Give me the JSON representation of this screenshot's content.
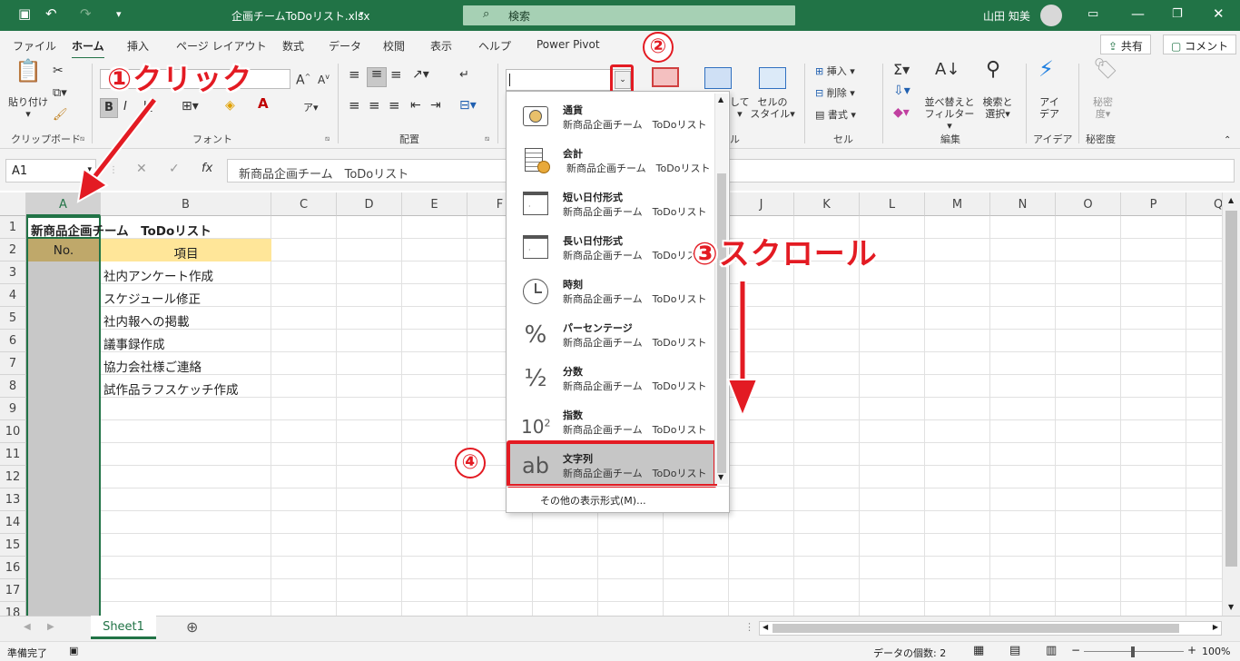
{
  "title": {
    "filename": "企画チームToDoリスト.xlsx",
    "search_placeholder": "検索",
    "user_name": "山田 知美"
  },
  "menu": {
    "tabs": [
      "ファイル",
      "ホーム",
      "挿入",
      "ページ レイアウト",
      "数式",
      "データ",
      "校閲",
      "表示",
      "ヘルプ",
      "Power Pivot"
    ],
    "active": "ホーム",
    "share": "共有",
    "comment": "コメント"
  },
  "ribbon": {
    "paste": "貼り付け",
    "clipboard": "クリップボード",
    "font": "フォント",
    "alignment": "配置",
    "cells": "セル",
    "editing": "編集",
    "ideas": "アイデア",
    "sensitivity": "秘密度",
    "insert": "挿入",
    "delete": "削除",
    "format": "書式",
    "sort_filter_1": "並べ替えと",
    "sort_filter_2": "フィルター",
    "find_select_1": "検索と",
    "find_select_2": "選択",
    "ideas_btn_1": "アイ",
    "ideas_btn_2": "デア",
    "sens_btn_1": "秘密",
    "sens_btn_2": "度",
    "cell_style_1": "セルの",
    "cell_style_2": "スタイル",
    "table_partial": "して",
    "font_bold": "B",
    "font_italic": "I",
    "font_underline": "U",
    "group_cells_partial": "ル"
  },
  "formula_bar": {
    "name_box": "A1",
    "formula": "新商品企画チーム　ToDoリスト"
  },
  "columns": [
    "A",
    "B",
    "C",
    "D",
    "E",
    "F",
    "",
    "",
    "",
    "J",
    "K",
    "L",
    "M",
    "N",
    "O",
    "P",
    "Q"
  ],
  "rows": [
    "1",
    "2",
    "3",
    "4",
    "5",
    "6",
    "7",
    "8",
    "9",
    "10",
    "11",
    "12",
    "13",
    "14",
    "15",
    "16",
    "17",
    "18"
  ],
  "cells": {
    "a1": "新商品企画チーム　ToDoリスト",
    "a2": "No.",
    "b2": "項目",
    "b3": "社内アンケート作成",
    "b4": "スケジュール修正",
    "b5": "社内報への掲載",
    "b6": "議事録作成",
    "b7": "協力会社様ご連絡",
    "b8": "試作品ラフスケッチ作成"
  },
  "dropdown": {
    "items": [
      {
        "name": "通貨",
        "example": "新商品企画チーム　ToDoリスト",
        "icon": "currency-icon"
      },
      {
        "name": "会計",
        "example": "新商品企画チーム　ToDoリスト",
        "icon": "accounting-icon"
      },
      {
        "name": "短い日付形式",
        "example": "新商品企画チーム　ToDoリスト",
        "icon": "short-date-icon"
      },
      {
        "name": "長い日付形式",
        "example": "新商品企画チーム　ToDoリスト",
        "icon": "long-date-icon"
      },
      {
        "name": "時刻",
        "example": "新商品企画チーム　ToDoリスト",
        "icon": "clock-icon"
      },
      {
        "name": "パーセンテージ",
        "example": "新商品企画チーム　ToDoリスト",
        "icon": "percent-icon"
      },
      {
        "name": "分数",
        "example": "新商品企画チーム　ToDoリスト",
        "icon": "fraction-icon"
      },
      {
        "name": "指数",
        "example": "新商品企画チーム　ToDoリスト",
        "icon": "exponent-icon"
      },
      {
        "name": "文字列",
        "example": "新商品企画チーム　ToDoリスト",
        "icon": "text-icon"
      }
    ],
    "more": "その他の表示形式(M)...",
    "icon_percent": "%",
    "icon_fraction": "½",
    "icon_exponent": "10",
    "icon_exponent_sup": "2",
    "icon_text": "ab"
  },
  "annotations": {
    "step1_num": "①",
    "step1": "クリック",
    "step2": "②",
    "step3_num": "③",
    "step3": "スクロール",
    "step4": "④"
  },
  "sheet": {
    "tab": "Sheet1"
  },
  "status": {
    "ready": "準備完了",
    "count": "データの個数: 2",
    "zoom": "100%"
  },
  "colors": {
    "excel_green": "#217346",
    "annotation_red": "#e31b23",
    "header_fill": "#ffe699",
    "selected_col": "#c8c8c8"
  }
}
